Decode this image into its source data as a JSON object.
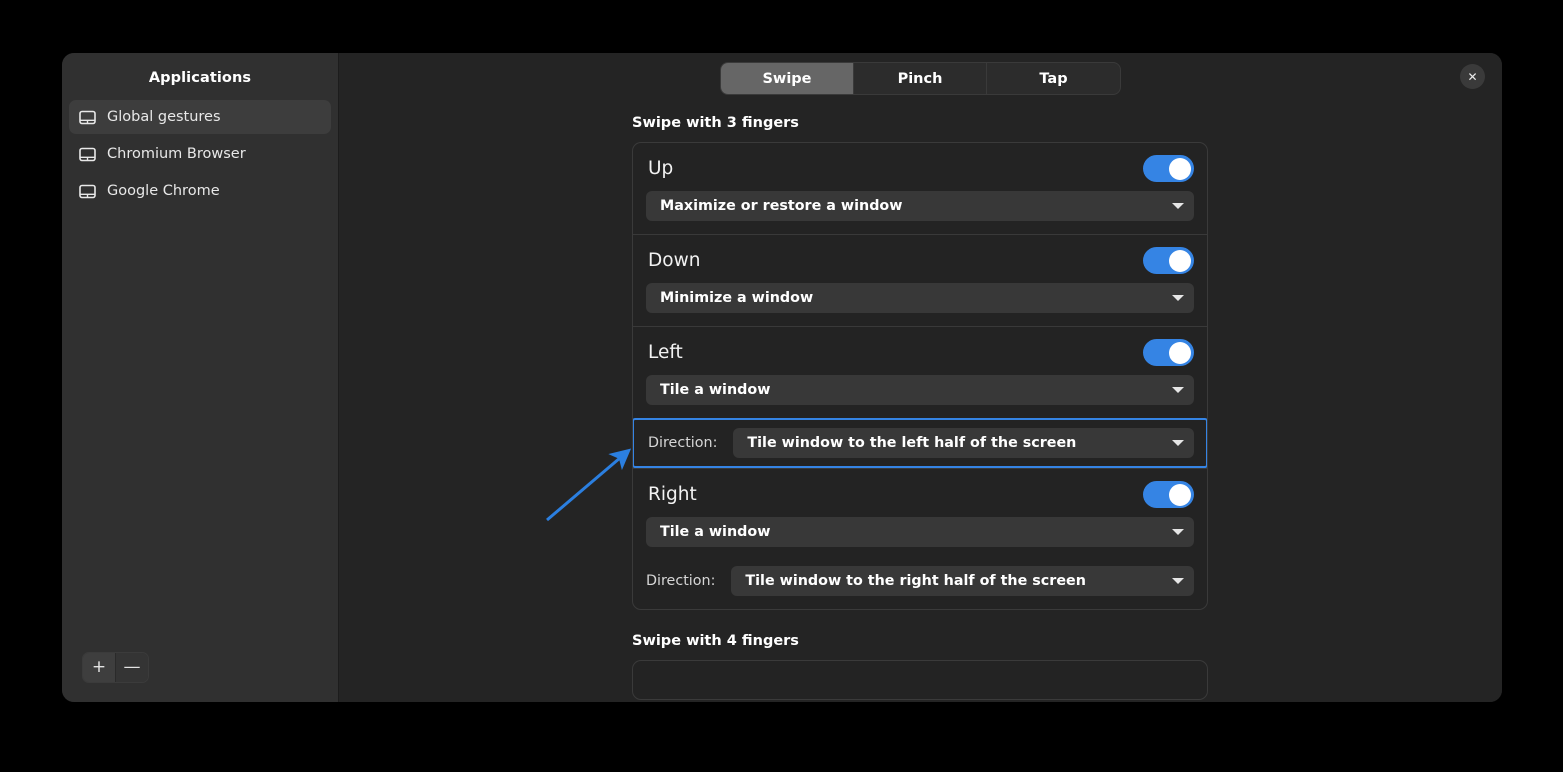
{
  "window": {
    "close_label": "✕"
  },
  "sidebar": {
    "title": "Applications",
    "items": [
      {
        "label": "Global gestures",
        "icon": "touchpad-icon",
        "selected": true
      },
      {
        "label": "Chromium Browser",
        "icon": "touchpad-icon",
        "selected": false
      },
      {
        "label": "Google Chrome",
        "icon": "touchpad-icon",
        "selected": false
      }
    ],
    "actions": {
      "add_label": "+",
      "remove_label": "—"
    }
  },
  "tabs": [
    {
      "label": "Swipe",
      "active": true
    },
    {
      "label": "Pinch",
      "active": false
    },
    {
      "label": "Tap",
      "active": false
    }
  ],
  "sections": [
    {
      "title": "Swipe with 3 fingers",
      "gestures": [
        {
          "name": "Up",
          "enabled": true,
          "action": "Maximize or restore a window",
          "direction": null
        },
        {
          "name": "Down",
          "enabled": true,
          "action": "Minimize a window",
          "direction": null
        },
        {
          "name": "Left",
          "enabled": true,
          "action": "Tile a window",
          "direction": {
            "label": "Direction:",
            "value": "Tile window to the left half of the screen",
            "highlighted": true
          }
        },
        {
          "name": "Right",
          "enabled": true,
          "action": "Tile a window",
          "direction": {
            "label": "Direction:",
            "value": "Tile window to the right half of the screen",
            "highlighted": false
          }
        }
      ]
    },
    {
      "title": "Swipe with 4 fingers",
      "gestures": []
    }
  ],
  "annotation": {
    "arrow_color": "#2b7fe0",
    "points_to": "direction-combobox-left"
  },
  "colors": {
    "accent": "#3584e4",
    "window_bg": "#242424",
    "sidebar_bg": "#303030",
    "combo_bg": "#383838",
    "highlight": "#3584e4"
  }
}
